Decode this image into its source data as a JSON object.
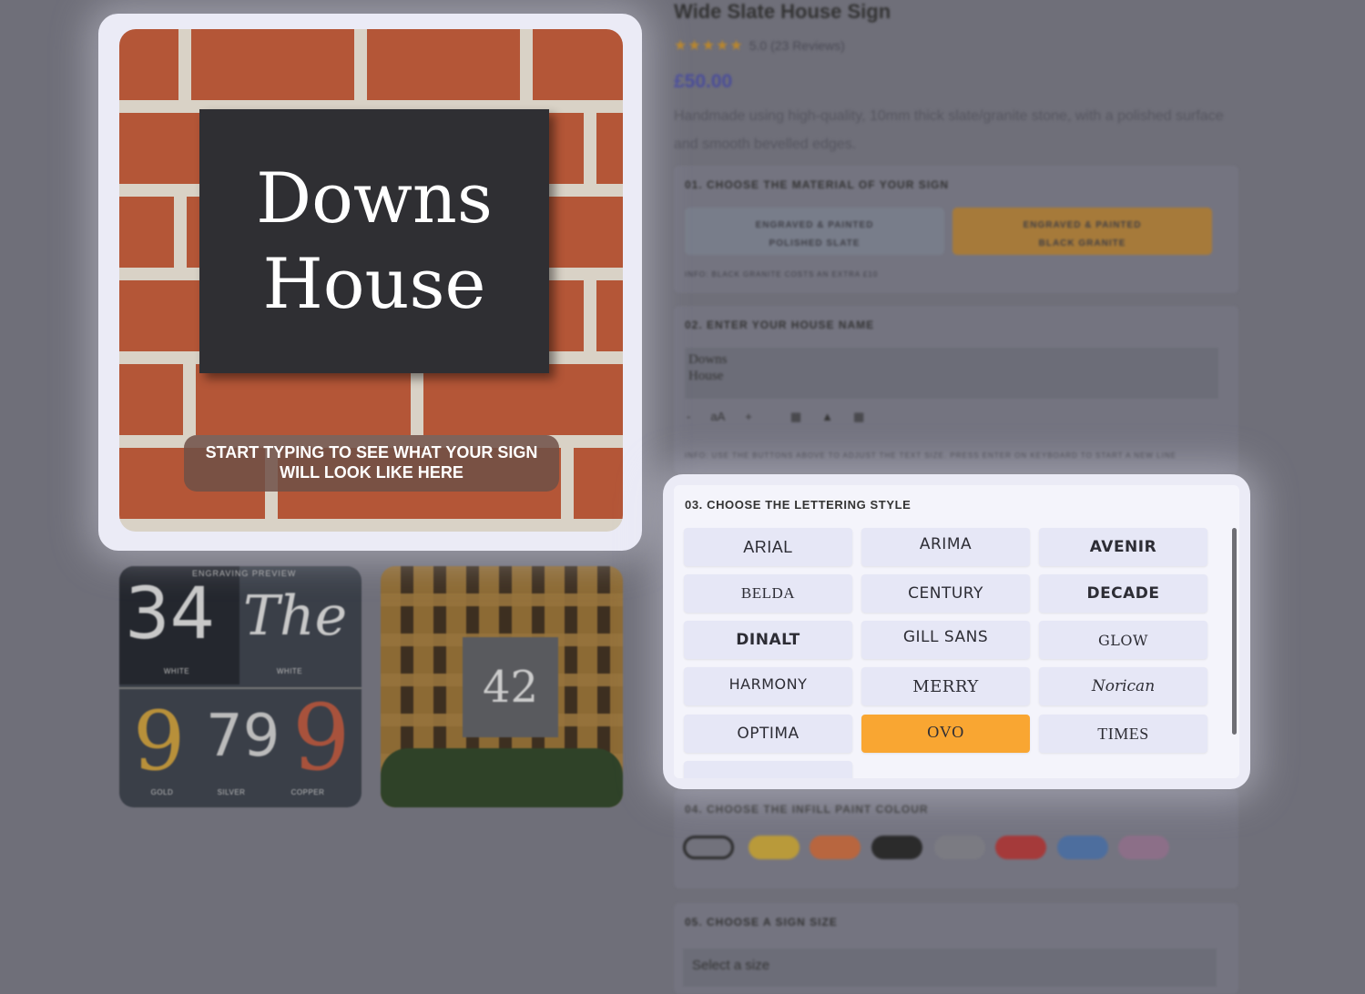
{
  "product": {
    "title": "Wide Slate House Sign",
    "stars": "★★★★★",
    "rating": "5.0 (23 Reviews)",
    "price": "£50.00",
    "description": "Handmade using high-quality, 10mm thick slate/granite stone, with a polished surface and smooth bevelled edges."
  },
  "step1": {
    "heading": "01. CHOOSE THE MATERIAL OF YOUR SIGN",
    "options": [
      {
        "line1": "ENGRAVED & PAINTED",
        "line2": "POLISHED SLATE",
        "selected": false
      },
      {
        "line1": "ENGRAVED & PAINTED",
        "line2": "BLACK GRANITE",
        "selected": true
      }
    ],
    "info": "INFO: BLACK GRANITE COSTS AN EXTRA £10"
  },
  "step2": {
    "heading": "02. ENTER YOUR HOUSE NAME",
    "value": "Downs\nHouse",
    "tools": {
      "minus": "-",
      "size": "aA",
      "plus": "+"
    },
    "info": "INFO: USE THE BUTTONS ABOVE TO ADJUST THE TEXT SIZE. PRESS ENTER ON KEYBOARD TO START A NEW LINE"
  },
  "step3": {
    "heading": "03. CHOOSE THE LETTERING STYLE",
    "fonts": [
      "ARIAL",
      "ARIMA",
      "AVENIR",
      "BELDA",
      "CENTURY",
      "DECADE",
      "DINALT",
      "GILL SANS",
      "GLOW",
      "HARMONY",
      "MERRY",
      "Norican",
      "OPTIMA",
      "OVO",
      "TIMES"
    ],
    "selected": "OVO"
  },
  "step4": {
    "heading": "04. CHOOSE THE INFILL PAINT COLOUR",
    "colors": [
      "#ffffff",
      "#b99a3a",
      "#b8663f",
      "#2b2b2b",
      "#8a8a8f",
      "#a53a3a",
      "#4d6e9e",
      "#9c7a96"
    ],
    "selected_index": 0
  },
  "step5": {
    "heading": "05. CHOOSE A SIGN SIZE",
    "placeholder": "Select a size"
  },
  "preview": {
    "line1": "Downs",
    "line2": "House",
    "caption": "START TYPING TO SEE WHAT YOUR SIGN WILL LOOK LIKE HERE"
  },
  "thumbs": {
    "t1": {
      "header": "ENGRAVING PREVIEW",
      "a": "34",
      "b": "The",
      "c": "9",
      "d": "79",
      "e": "9",
      "labels": [
        "WHITE",
        "WHITE",
        "GOLD",
        "SILVER",
        "COPPER"
      ]
    },
    "t2": {
      "number": "42"
    }
  },
  "colors": {
    "accent": "#f9a632",
    "price": "#4a4d9a"
  }
}
